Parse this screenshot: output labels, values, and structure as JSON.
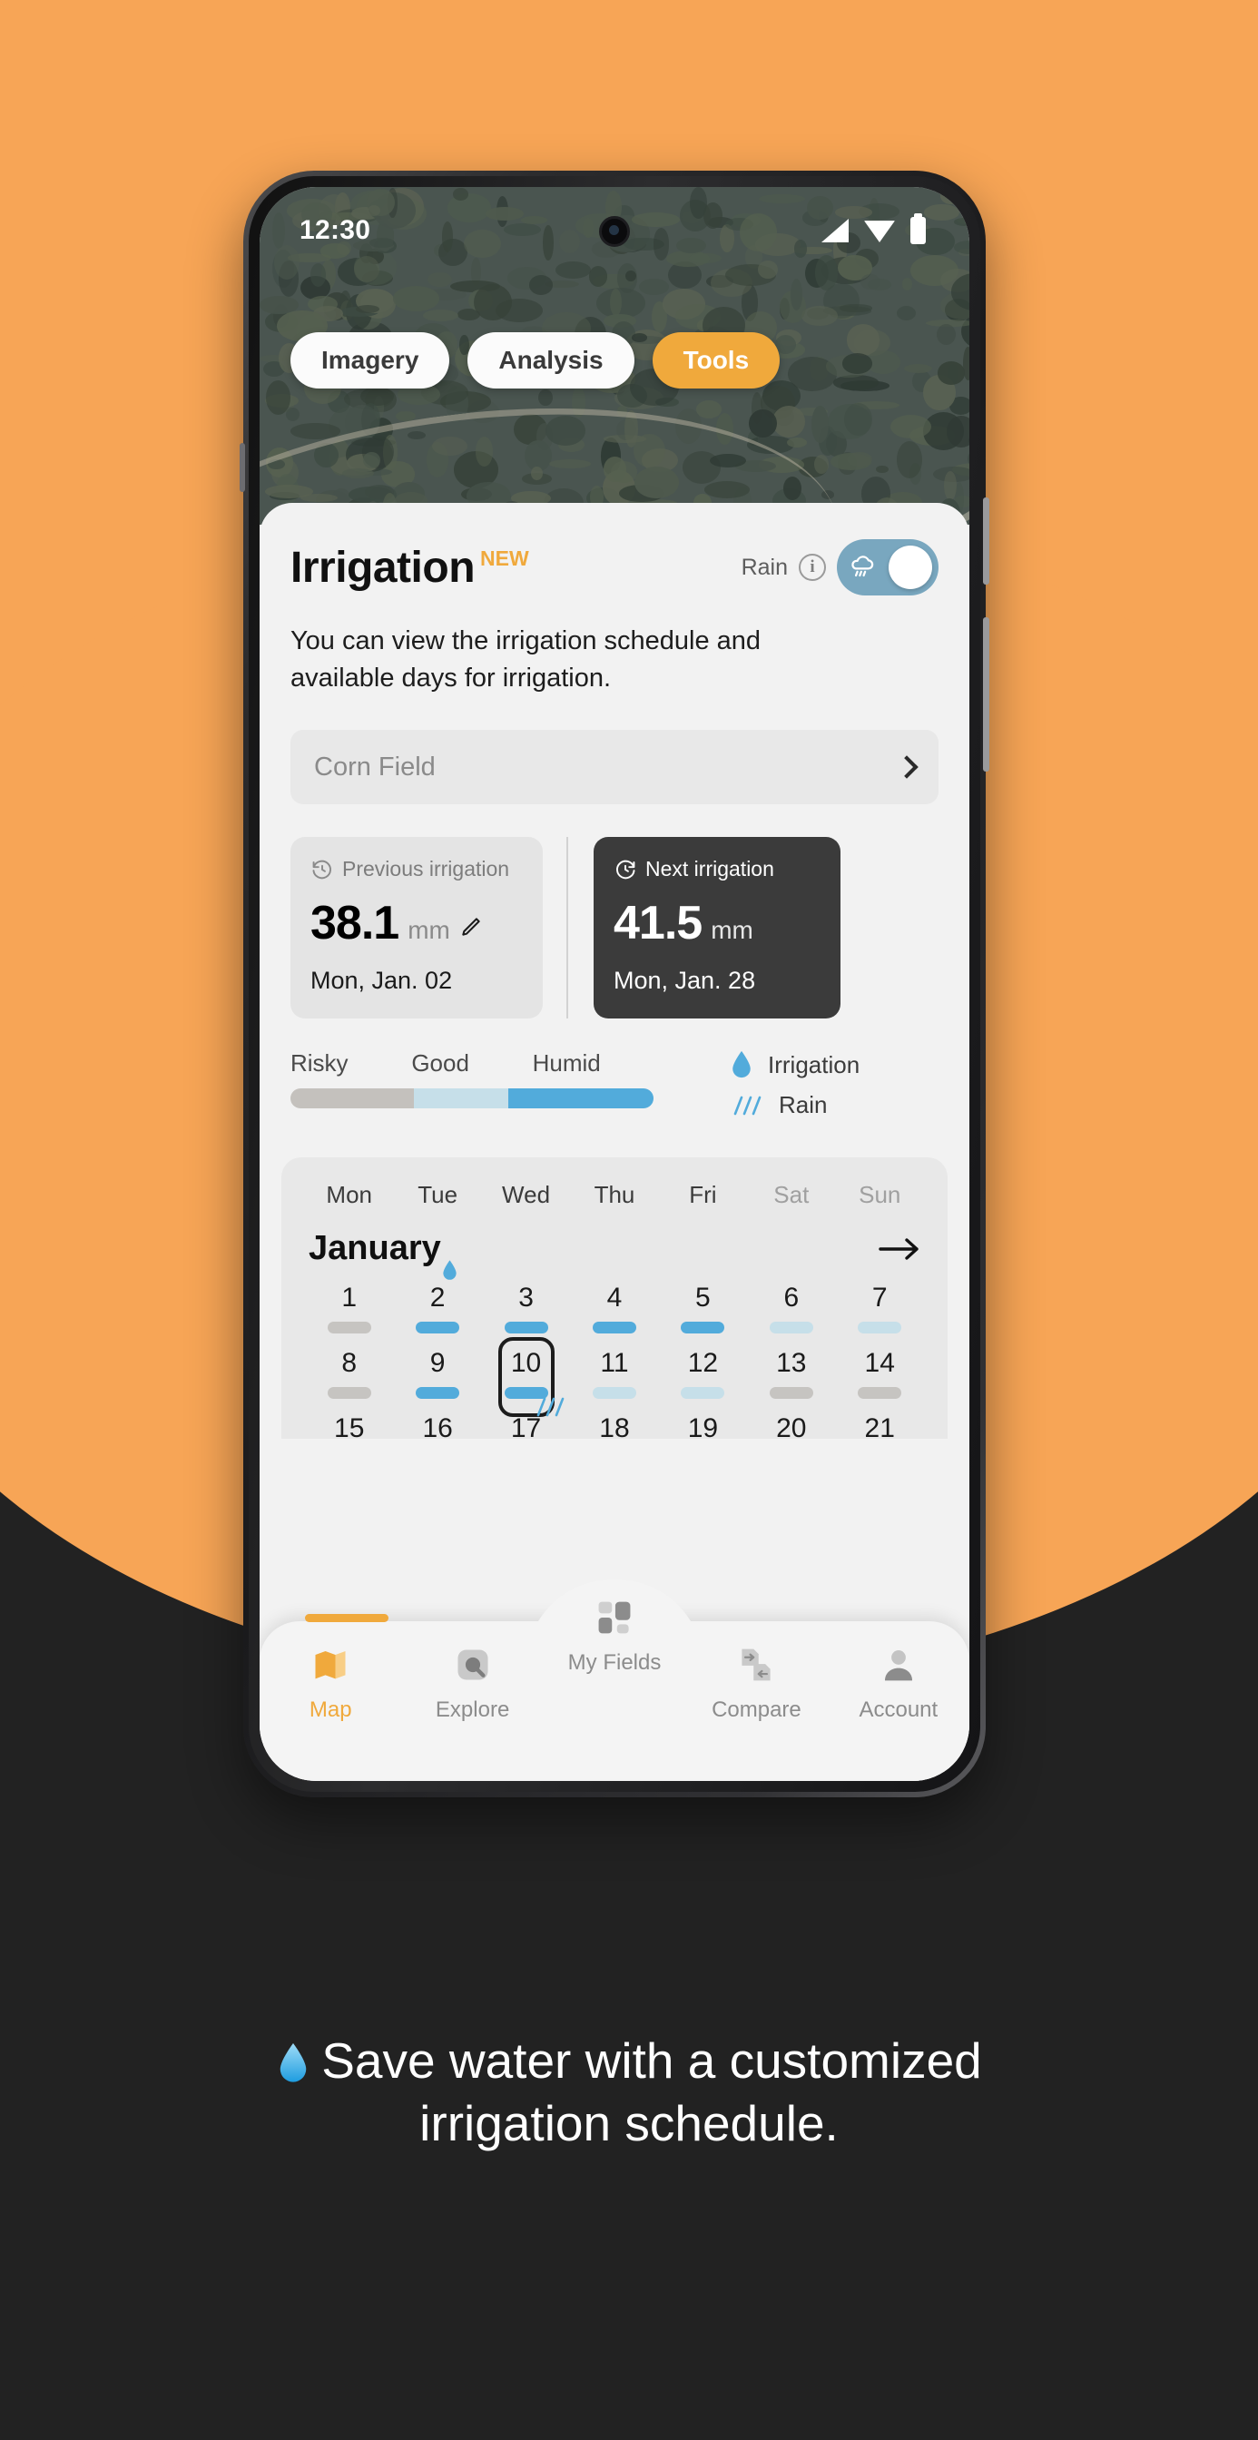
{
  "theme": {
    "orange": "#F7A556",
    "accent": "#F0A93C",
    "blue": "#52ABDB",
    "light_blue": "#C6DFE9",
    "gray_bar": "#C6C4C1",
    "dark": "#222222",
    "toggle_on": "#79A7BF"
  },
  "status_bar": {
    "time": "12:30",
    "icons": [
      "signal-icon",
      "wifi-icon",
      "battery-icon"
    ]
  },
  "map_tabs": [
    {
      "label": "Imagery",
      "active": false
    },
    {
      "label": "Analysis",
      "active": false
    },
    {
      "label": "Tools",
      "active": true
    }
  ],
  "panel": {
    "title": "Irrigation",
    "badge": "NEW",
    "rain_label": "Rain",
    "info_icon": "info-icon",
    "toggle_icon": "rain-cloud-icon",
    "toggle_state": "on",
    "description": "You can view the irrigation schedule and available days for irrigation.",
    "field_selector": {
      "value": "Corn Field",
      "chevron": "chevron-right-icon"
    },
    "cards": [
      {
        "icon": "history-clock-icon",
        "label": "Previous irrigation",
        "value": "38.1",
        "unit": "mm",
        "edit_icon": "pencil-icon",
        "date": "Mon, Jan. 02",
        "style": "light"
      },
      {
        "icon": "forward-clock-icon",
        "label": "Next irrigation",
        "value": "41.5",
        "unit": "mm",
        "date": "Mon, Jan. 28",
        "style": "dark"
      }
    ],
    "scale": {
      "labels": [
        "Risky",
        "Good",
        "Humid"
      ],
      "segments": [
        {
          "name": "Risky",
          "color": "#C4C1BD",
          "width_pct": 34
        },
        {
          "name": "Good",
          "color": "#C6DFE9",
          "width_pct": 26
        },
        {
          "name": "Humid",
          "color": "#52ABDB",
          "width_pct": 40
        }
      ]
    },
    "legend": [
      {
        "icon": "water-drop-icon",
        "label": "Irrigation"
      },
      {
        "icon": "rain-lines-icon",
        "label": "Rain"
      }
    ]
  },
  "calendar": {
    "weekdays": [
      {
        "label": "Mon",
        "weekend": false
      },
      {
        "label": "Tue",
        "weekend": false
      },
      {
        "label": "Wed",
        "weekend": false
      },
      {
        "label": "Thu",
        "weekend": false
      },
      {
        "label": "Fri",
        "weekend": false
      },
      {
        "label": "Sat",
        "weekend": true
      },
      {
        "label": "Sun",
        "weekend": true
      }
    ],
    "month": "January",
    "next_icon": "arrow-right-icon",
    "rows": [
      [
        {
          "day": "1",
          "bar": "gray",
          "marker": null
        },
        {
          "day": "2",
          "bar": "blue",
          "marker": "drop"
        },
        {
          "day": "3",
          "bar": "blue",
          "marker": null
        },
        {
          "day": "4",
          "bar": "blue",
          "marker": null
        },
        {
          "day": "5",
          "bar": "blue",
          "marker": null
        },
        {
          "day": "6",
          "bar": "lblue",
          "marker": null
        },
        {
          "day": "7",
          "bar": "lblue",
          "marker": null
        }
      ],
      [
        {
          "day": "8",
          "bar": "gray",
          "marker": null
        },
        {
          "day": "9",
          "bar": "blue",
          "marker": null
        },
        {
          "day": "10",
          "bar": "blue",
          "marker": null,
          "selected": true
        },
        {
          "day": "11",
          "bar": "lblue",
          "marker": null
        },
        {
          "day": "12",
          "bar": "lblue",
          "marker": null
        },
        {
          "day": "13",
          "bar": "gray",
          "marker": null
        },
        {
          "day": "14",
          "bar": "gray",
          "marker": null
        }
      ],
      [
        {
          "day": "15",
          "bar": "none",
          "marker": null
        },
        {
          "day": "16",
          "bar": "none",
          "marker": null
        },
        {
          "day": "17",
          "bar": "none",
          "marker": "rain"
        },
        {
          "day": "18",
          "bar": "none",
          "marker": null
        },
        {
          "day": "19",
          "bar": "none",
          "marker": null
        },
        {
          "day": "20",
          "bar": "none",
          "marker": null
        },
        {
          "day": "21",
          "bar": "none",
          "marker": null
        }
      ]
    ]
  },
  "bottom_nav": [
    {
      "label": "Map",
      "icon": "map-icon",
      "active": true
    },
    {
      "label": "Explore",
      "icon": "explore-icon",
      "active": false
    },
    {
      "label": "My Fields",
      "icon": "fields-icon",
      "active": false,
      "center": true
    },
    {
      "label": "Compare",
      "icon": "compare-icon",
      "active": false
    },
    {
      "label": "Account",
      "icon": "account-icon",
      "active": false
    }
  ],
  "caption": {
    "icon": "water-drop-icon",
    "line1": "Save water with a customized",
    "line2": "irrigation schedule."
  }
}
